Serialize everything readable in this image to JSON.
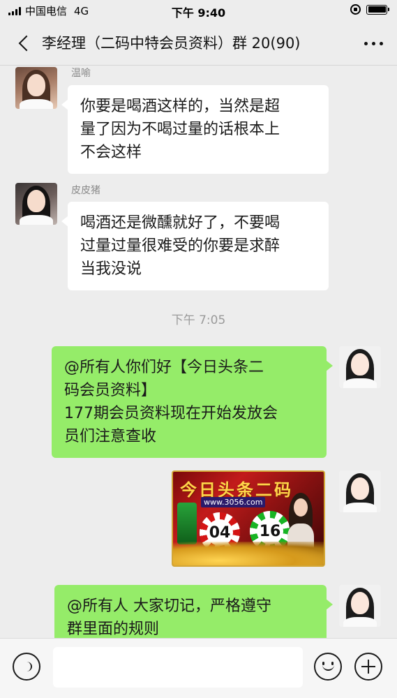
{
  "status_bar": {
    "carrier": "中国电信",
    "network": "4G",
    "time": "下午 9:40"
  },
  "header": {
    "title": "李经理（二码中特会员资料）群 20(90)",
    "back_icon": "chevron-left-icon",
    "more_icon": "more-icon"
  },
  "messages": [
    {
      "sender": "温喻",
      "direction": "incoming",
      "type": "text",
      "text_lines": [
        "你要是喝酒这样的，当然是超",
        "量了因为不喝过量的话根本上",
        "不会这样"
      ]
    },
    {
      "sender": "皮皮猪",
      "direction": "incoming",
      "type": "text",
      "text_lines": [
        "喝酒还是微醺就好了，不要喝",
        "过量过量很难受的你要是求醉",
        "当我没说"
      ]
    },
    {
      "type": "timestamp",
      "text": "下午 7:05"
    },
    {
      "direction": "outgoing",
      "type": "text",
      "text_lines": [
        "@所有人你们好【今日头条二",
        "码会员资料】",
        "177期会员资料现在开始发放会",
        "员们注意查收"
      ]
    },
    {
      "direction": "outgoing",
      "type": "image",
      "image": {
        "banner": "今日头条二码",
        "url": "www.3056.com",
        "numbers": [
          "04",
          "16"
        ]
      }
    },
    {
      "direction": "outgoing",
      "type": "text",
      "text_lines": [
        "@所有人  大家切记，严格遵守",
        "群里面的规则"
      ]
    }
  ],
  "input_bar": {
    "voice_icon": "voice-icon",
    "emoji_icon": "emoji-icon",
    "plus_icon": "plus-icon",
    "placeholder": ""
  }
}
